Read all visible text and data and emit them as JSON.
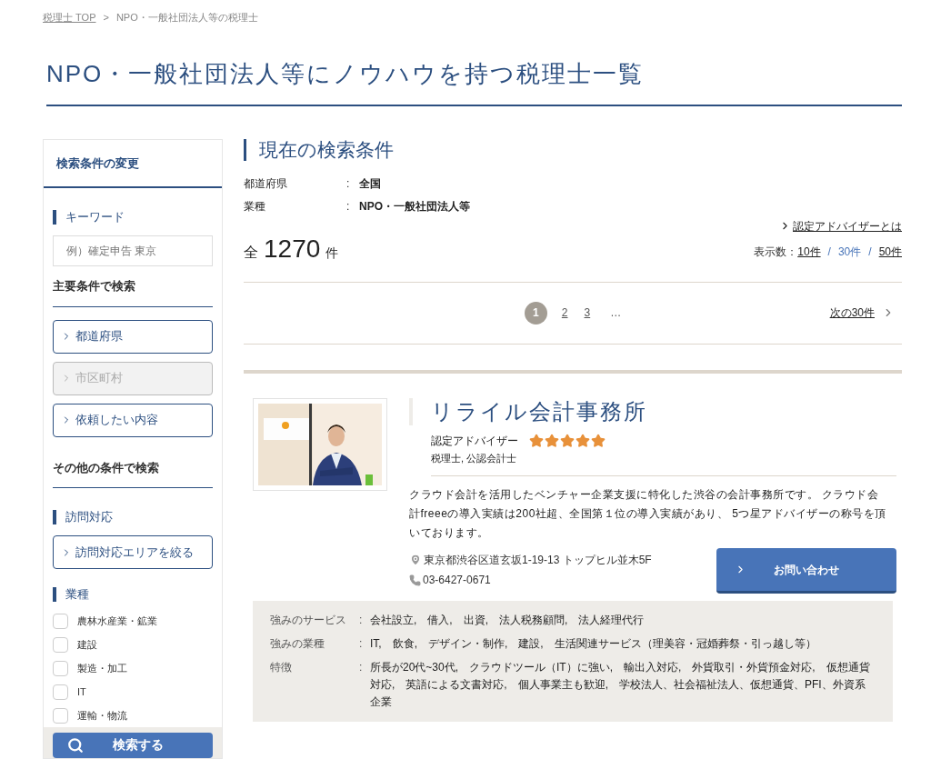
{
  "breadcrumb": {
    "home": "税理士 TOP",
    "separator": ">",
    "current": "NPO・一般社団法人等の税理士"
  },
  "title": "NPO・一般社団法人等にノウハウを持つ税理士一覧",
  "sidebar": {
    "heading": "検索条件の変更",
    "keyword": {
      "label": "キーワード",
      "placeholder": "例）確定申告 東京"
    },
    "main_heading": "主要条件で検索",
    "main_buttons": [
      {
        "label": "都道府県",
        "disabled": false
      },
      {
        "label": "市区町村",
        "disabled": true
      },
      {
        "label": "依頼したい内容",
        "disabled": false
      }
    ],
    "other_heading": "その他の条件で検索",
    "visit": {
      "label": "訪問対応",
      "button": "訪問対応エリアを絞る"
    },
    "industry": {
      "label": "業種",
      "options": [
        {
          "label": "農林水産業・鉱業",
          "checked": false
        },
        {
          "label": "建設",
          "checked": false
        },
        {
          "label": "製造・加工",
          "checked": false
        },
        {
          "label": "IT",
          "checked": false
        },
        {
          "label": "運輸・物流",
          "checked": false
        }
      ]
    },
    "search_button": "検索する"
  },
  "conditions": {
    "heading": "現在の検索条件",
    "separator": ":",
    "rows": [
      {
        "label": "都道府県",
        "value": "全国"
      },
      {
        "label": "業種",
        "value": "NPO・一般社団法人等"
      }
    ]
  },
  "advisor_link": "認定アドバイザーとは",
  "total": {
    "prefix": "全",
    "count": "1270",
    "suffix": "件"
  },
  "per_page": {
    "label": "表示数：",
    "separator": "/",
    "options": [
      {
        "label": "10件",
        "selected": false
      },
      {
        "label": "30件",
        "selected": true
      },
      {
        "label": "50件",
        "selected": false
      }
    ]
  },
  "pagination": {
    "pages": [
      {
        "label": "1",
        "selected": true
      },
      {
        "label": "2",
        "selected": false
      },
      {
        "label": "3",
        "selected": false
      }
    ],
    "ellipsis": "…",
    "next": "次の30件"
  },
  "office": {
    "name": "リライル会計事務所",
    "badge": "認定アドバイザー",
    "stars": 5,
    "qualifications": "税理士, 公認会計士",
    "description": "クラウド会計を活用したベンチャー企業支援に特化した渋谷の会計事務所です。 クラウド会計freeeの導入実績は200社超、全国第１位の導入実績があり、 5つ星アドバイザーの称号を頂いております。",
    "address": "東京都渋谷区道玄坂1-19-13 トップヒル並木5F",
    "phone": "03-6427-0671",
    "contact_button": "お問い合わせ",
    "details_separator": ":",
    "details": [
      {
        "label": "強みのサービス",
        "value": "会社設立,　借入,　出資,　法人税務顧問,　法人経理代行"
      },
      {
        "label": "強みの業種",
        "value": "IT,　飲食,　デザイン・制作,　建設,　生活関連サービス（理美容・冠婚葬祭・引っ越し等）"
      },
      {
        "label": "特徴",
        "value": "所長が20代~30代,　クラウドツール（IT）に強い,　輸出入対応,　外貨取引・外貨預金対応,　仮想通貨対応,　英語による文書対応,　個人事業主も歓迎,　学校法人、社会福祉法人、仮想通貨、PFI、外資系企業"
      }
    ]
  }
}
